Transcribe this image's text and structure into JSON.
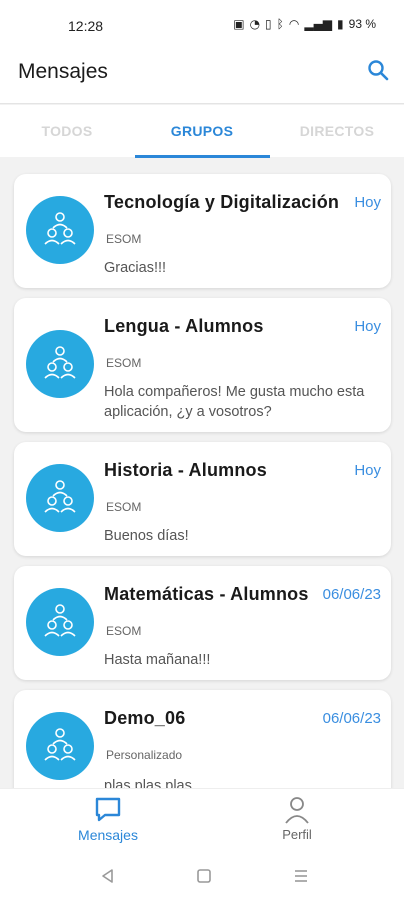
{
  "status": {
    "time": "12:28",
    "battery": "93 %"
  },
  "header": {
    "title": "Mensajes"
  },
  "tabs": [
    {
      "label": "TODOS",
      "active": false
    },
    {
      "label": "GRUPOS",
      "active": true
    },
    {
      "label": "DIRECTOS",
      "active": false
    }
  ],
  "chats": [
    {
      "title": "Tecnología y Digitalización",
      "date": "Hoy",
      "subtitle": "ESOM",
      "message": "Gracias!!!"
    },
    {
      "title": "Lengua - Alumnos",
      "date": "Hoy",
      "subtitle": "ESOM",
      "message": "Hola compañeros! Me gusta mucho esta aplicación, ¿y a vosotros?"
    },
    {
      "title": "Historia - Alumnos",
      "date": "Hoy",
      "subtitle": "ESOM",
      "message": "Buenos días!"
    },
    {
      "title": "Matemáticas - Alumnos",
      "date": "06/06/23",
      "subtitle": "ESOM",
      "message": "Hasta mañana!!!"
    },
    {
      "title": "Demo_06",
      "date": "06/06/23",
      "subtitle": "Personalizado",
      "message": "plas plas plas"
    }
  ],
  "bottom_nav": {
    "messages_label": "Mensajes",
    "profile_label": "Perfil"
  },
  "colors": {
    "accent": "#2b87d8",
    "avatar": "#28a9e0"
  }
}
